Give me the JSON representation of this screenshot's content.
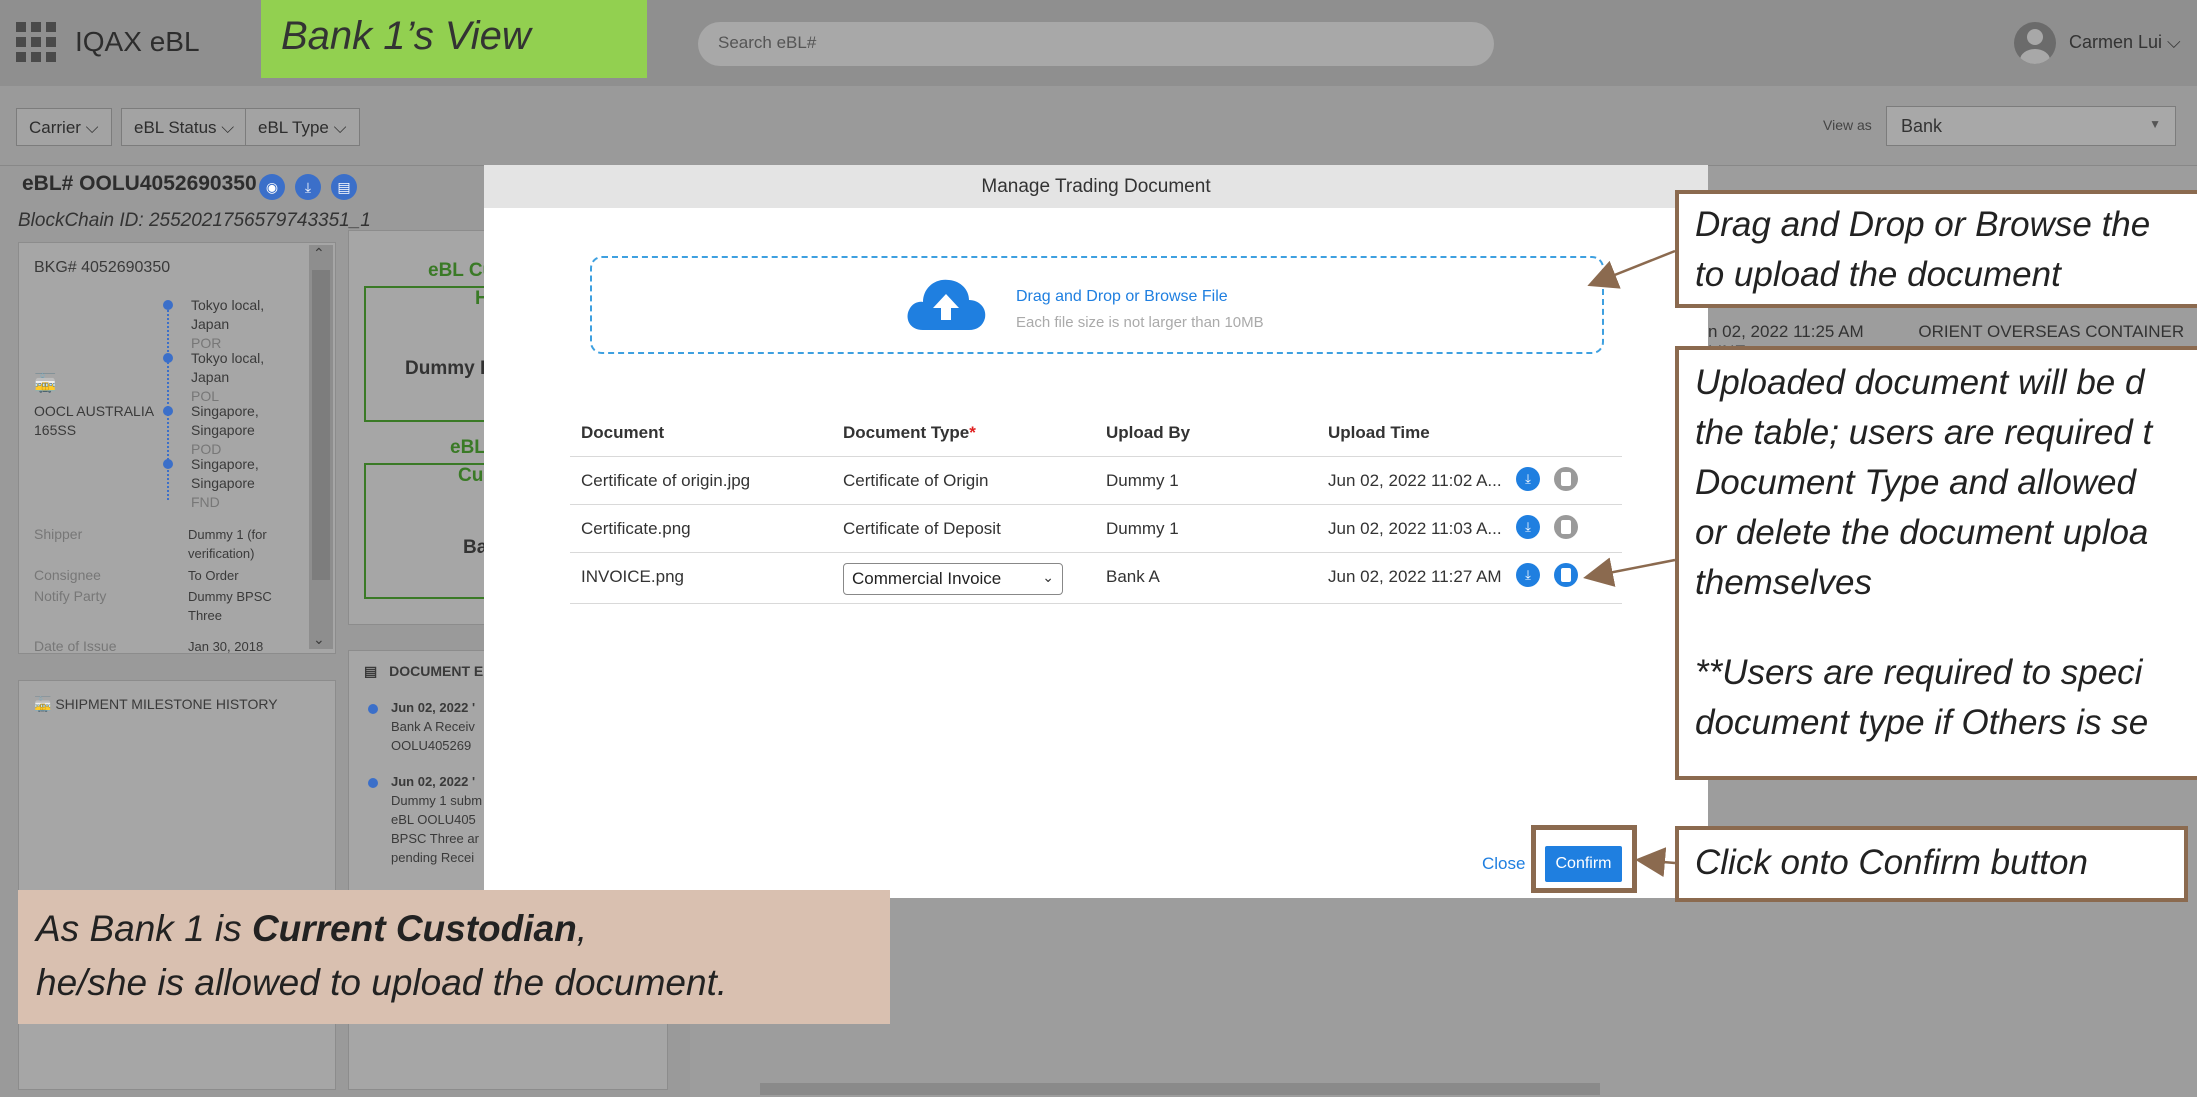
{
  "header": {
    "app_title": "IQAX eBL",
    "view_banner": "Bank 1’s View",
    "search_placeholder": "Search eBL#",
    "user_name": "Carmen Lui ⌵"
  },
  "filters": {
    "carrier": "Carrier ⌵",
    "ebl_status": "eBL Status ⌵",
    "ebl_type": "eBL Type ⌵",
    "view_as_label": "View as",
    "view_as_value": "Bank"
  },
  "left_panel": {
    "ebl_number": "eBL# OOLU4052690350",
    "blockchain_id": "BlockChain ID: 2552021756579743351_1",
    "bkg": "BKG# 4052690350",
    "route": [
      {
        "place": "Tokyo local,",
        "place2": "Japan",
        "code": "POR"
      },
      {
        "place": "Tokyo local,",
        "place2": "Japan",
        "code": "POL"
      },
      {
        "place": "Singapore,",
        "place2": "Singapore",
        "code": "POD"
      },
      {
        "place": "Singapore,",
        "place2": "Singapore",
        "code": "FND"
      }
    ],
    "vessel": "OOCL AUSTRALIA",
    "voyage": "165SS",
    "fields": [
      {
        "label": "Shipper",
        "value": "Dummy 1 (for",
        "value2": "verification)"
      },
      {
        "label": "Consignee",
        "value": "To Order"
      },
      {
        "label": "Notify Party",
        "value": "Dummy BPSC",
        "value2": "Three"
      },
      {
        "label": "Date of Issue",
        "value": "Jan 30, 2018"
      }
    ],
    "milestone_title": "SHIPMENT MILESTONE HISTORY"
  },
  "mid_panel": {
    "ebl_current_partial": "eBL Cu",
    "holder_partial": "H",
    "dummy_partial": "Dummy E",
    "ebl2_partial": "eBL",
    "cus_partial": "Cu",
    "ba_partial": "Ba",
    "doc_title_partial": "DOCUMENT E",
    "events": [
      {
        "date": "Jun 02, 2022 '",
        "l1": "Bank A Receiv",
        "l2": "OOLU40526​9"
      },
      {
        "date": "Jun 02, 2022 '",
        "l1": "Dummy 1 subm",
        "l2": "eBL OOLU405",
        "l3": "BPSC Three ar",
        "l4": "pending Recei"
      }
    ]
  },
  "background_row": {
    "time": "n 02, 2022 11:25 AM",
    "carrier": "ORIENT OVERSEAS CONTAINER LINE"
  },
  "modal": {
    "title": "Manage Trading Document",
    "dropzone_main": "Drag and Drop or Browse File",
    "dropzone_sub": "Each file size is not larger than 10MB",
    "columns": {
      "document": "Document",
      "document_type": "Document Type",
      "required_mark": "*",
      "upload_by": "Upload By",
      "upload_time": "Upload Time"
    },
    "rows": [
      {
        "document": "Certificate of origin.jpg",
        "type": "Certificate of Origin",
        "by": "Dummy 1",
        "time": "Jun 02, 2022 11:02 A..."
      },
      {
        "document": "Certificate.png",
        "type": "Certificate of Deposit",
        "by": "Dummy 1",
        "time": "Jun 02, 2022 11:03 A..."
      },
      {
        "document": "INVOICE.png",
        "type": "Commercial Invoice",
        "by": "Bank A",
        "time": "Jun 02, 2022 11:27 AM"
      }
    ],
    "close_label": "Close",
    "confirm_label": "Confirm"
  },
  "annotations": {
    "drag_l1": "Drag and Drop or Browse the",
    "drag_l2": "to upload the document",
    "upload_l1": "Uploaded document will be d",
    "upload_l2": "the table; users are required t",
    "upload_l3": "Document Type and allowed",
    "upload_l4": "or delete the document uploa",
    "upload_l5": "themselves",
    "upload_l6": "**Users are required to speci",
    "upload_l7": "document type if Others is se",
    "confirm_note": "Click onto Confirm button",
    "custodian_l1_pre": "As Bank 1 is ",
    "custodian_l1_bold": "Current Custodian",
    "custodian_l1_post": ",",
    "custodian_l2": "he/she is allowed to upload the document."
  },
  "colors": {
    "banner_green": "#92d050",
    "accent_blue": "#1f7fe0",
    "callout_border": "#8b6a4f",
    "note_bg": "#d9c0b0"
  }
}
